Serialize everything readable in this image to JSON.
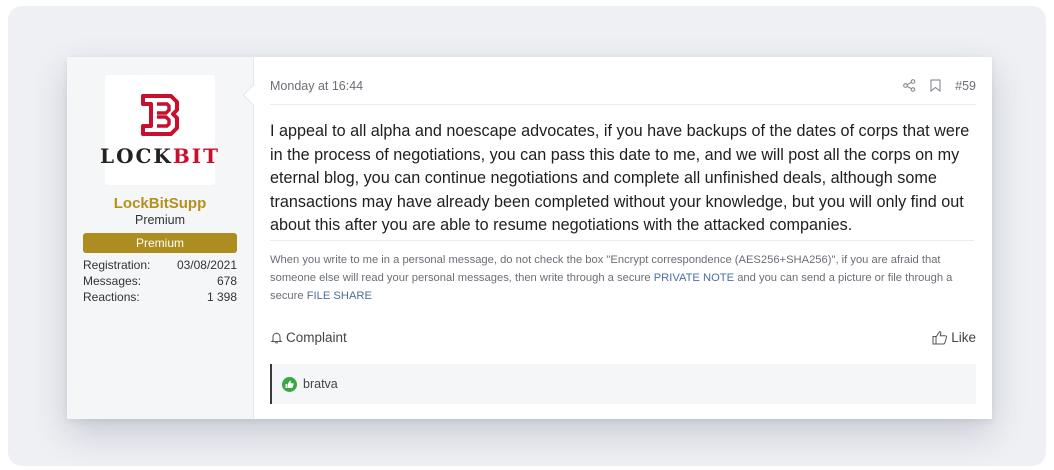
{
  "user": {
    "logo_text_main": "LOCK",
    "logo_text_accent": "BIT",
    "username": "LockBitSupp",
    "user_title": "Premium",
    "banner": "Premium",
    "stats": [
      {
        "label": "Registration:",
        "value": "03/08/2021"
      },
      {
        "label": "Messages:",
        "value": "678"
      },
      {
        "label": "Reactions:",
        "value": "1 398"
      }
    ]
  },
  "post": {
    "date": "Monday at 16:44",
    "post_number": "#59",
    "body": "I appeal to all alpha and noescape advocates, if you have backups of the dates of corps that were in the process of negotiations, you can pass this date to me, and we will post all the corps on my eternal blog, you can continue negotiations and complete all unfinished deals, although some transactions may have already been completed without your knowledge, but you will only find out about this after you are able to resume negotiations with the attacked companies.",
    "signature": {
      "text_before": "When you write to me in a personal message, do not check the box \"Encrypt correspondence (AES256+SHA256)\", if you are afraid that someone else will read your personal messages, then write through a secure ",
      "link1": "PRIVATE NOTE",
      "text_middle": " and you can send a picture or file through a secure ",
      "link2": "FILE SHARE"
    },
    "complaint_label": "Complaint",
    "like_label": "Like",
    "reaction_user": "bratva"
  },
  "colors": {
    "username": "#b7901a",
    "banner": "#ad8d1f",
    "link": "#4a6fa1",
    "reaction": "#3aa845",
    "logo_red": "#c8102e"
  },
  "icons": {
    "share": "share-icon",
    "bookmark": "bookmark-icon",
    "complaint": "bell-icon",
    "like": "thumbs-up-icon",
    "reaction": "like-reaction-icon"
  }
}
